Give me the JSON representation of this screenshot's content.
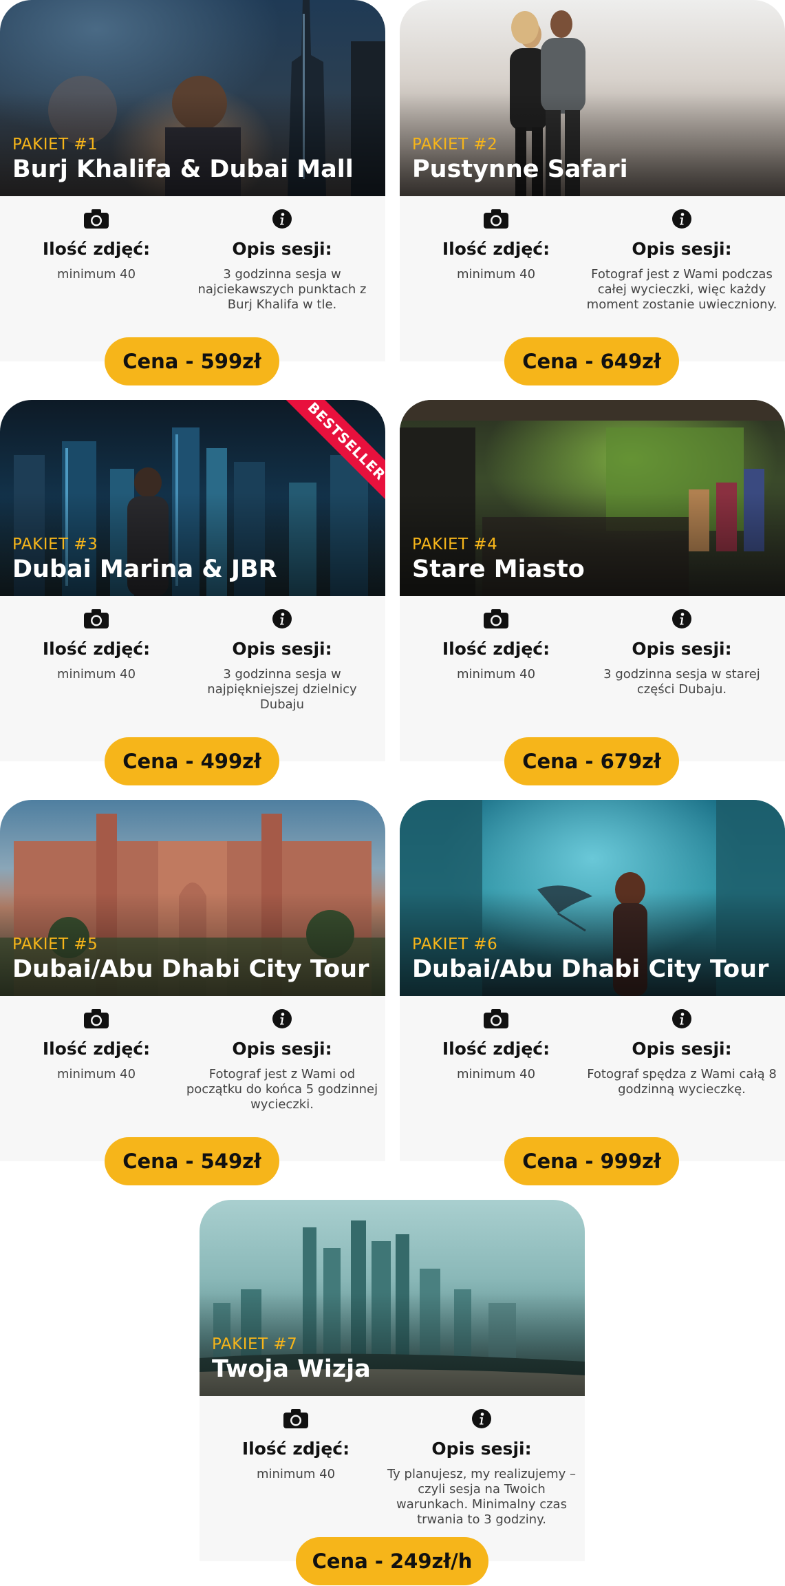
{
  "packages": [
    {
      "label": "PAKIET #1",
      "title": "Burj Khalifa & Dubai Mall",
      "photos_heading": "Ilość zdjęć:",
      "photos_value": "minimum 40",
      "desc_heading": "Opis sesji:",
      "desc": "3 godzinna sesja w najciekawszych punktach z Burj Khalifa w tle.",
      "price": "Cena - 599zł"
    },
    {
      "label": "PAKIET #2",
      "title": "Pustynne Safari",
      "photos_heading": "Ilość zdjęć:",
      "photos_value": "minimum 40",
      "desc_heading": "Opis sesji:",
      "desc": "Fotograf jest z Wami podczas całej wycieczki, więc każdy moment zostanie uwieczniony.",
      "price": "Cena - 649zł"
    },
    {
      "label": "PAKIET #3",
      "title": "Dubai Marina & JBR",
      "photos_heading": "Ilość zdjęć:",
      "photos_value": "minimum 40",
      "desc_heading": "Opis sesji:",
      "desc": "3 godzinna sesja w najpiękniejszej dzielnicy Dubaju",
      "price": "Cena - 499zł",
      "badge": "BESTSELLER"
    },
    {
      "label": "PAKIET #4",
      "title": "Stare Miasto",
      "photos_heading": "Ilość zdjęć:",
      "photos_value": "minimum 40",
      "desc_heading": "Opis sesji:",
      "desc": "3 godzinna sesja w starej części Dubaju.",
      "price": "Cena - 679zł"
    },
    {
      "label": "PAKIET #5",
      "title": "Dubai/Abu Dhabi City Tour",
      "photos_heading": "Ilość zdjęć:",
      "photos_value": "minimum 40",
      "desc_heading": "Opis sesji:",
      "desc": "Fotograf jest z Wami od początku do końca 5 godzinnej wycieczki.",
      "price": "Cena - 549zł"
    },
    {
      "label": "PAKIET #6",
      "title": "Dubai/Abu Dhabi City Tour",
      "photos_heading": "Ilość zdjęć:",
      "photos_value": "minimum 40",
      "desc_heading": "Opis sesji:",
      "desc": "Fotograf spędza z Wami całą 8 godzinną wycieczkę.",
      "price": "Cena - 999zł"
    },
    {
      "label": "PAKIET #7",
      "title": "Twoja Wizja",
      "photos_heading": "Ilość zdjęć:",
      "photos_value": "minimum 40",
      "desc_heading": "Opis sesji:",
      "desc": "Ty planujesz, my realizujemy – czyli sesja na Twoich warunkach. Minimalny czas trwania to 3 godziny.",
      "price": "Cena - 249zł/h"
    }
  ],
  "icons": {
    "photos": "camera-icon",
    "description": "info-icon"
  },
  "colors": {
    "accent": "#f6b51a",
    "badge": "#e8113d",
    "panel": "#f7f7f7"
  }
}
